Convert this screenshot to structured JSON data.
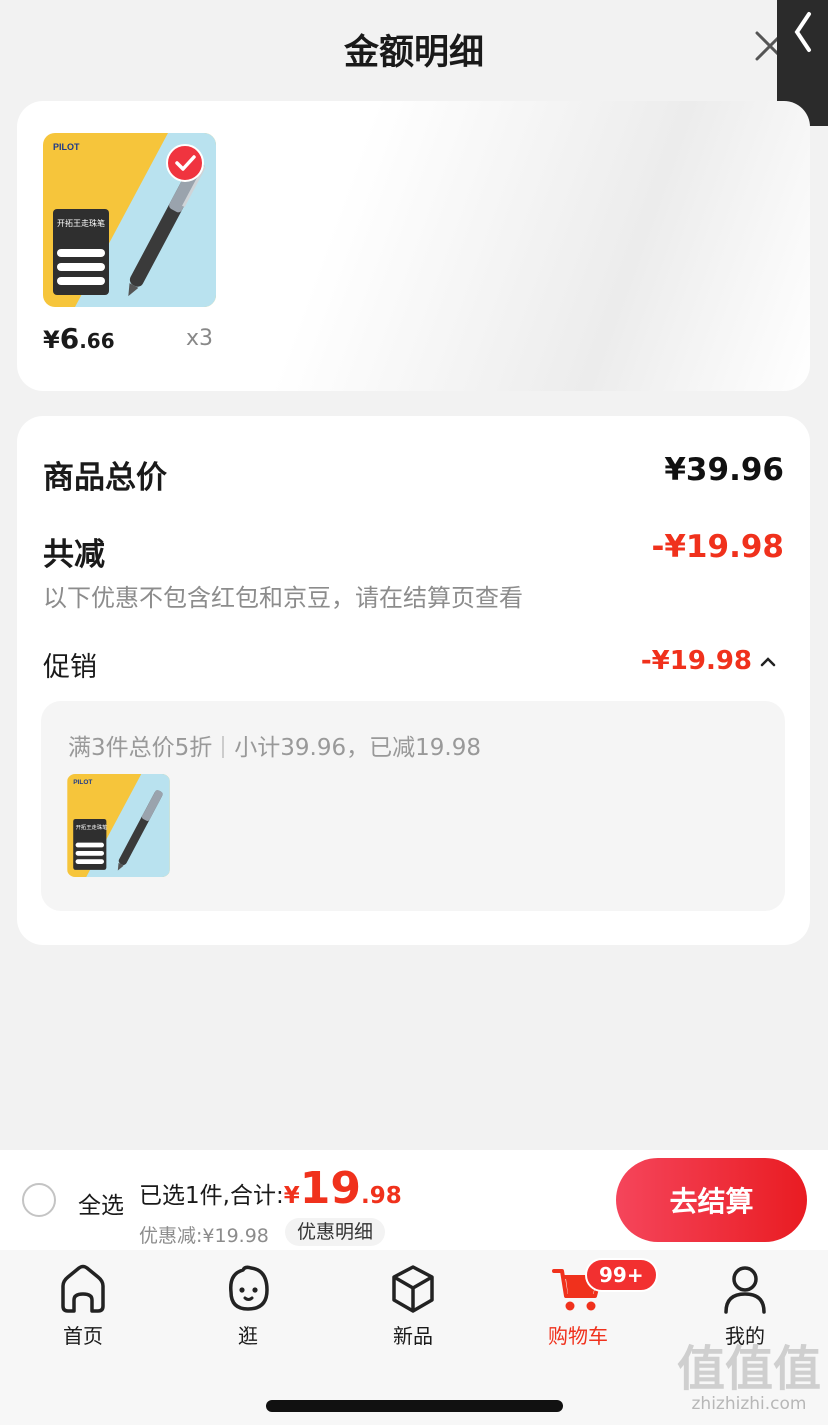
{
  "header": {
    "title": "金额明细"
  },
  "product": {
    "price_currency": "¥",
    "price_int": "6",
    "price_dec": ".66",
    "quantity": "x3",
    "brand": "PILOT",
    "packaging_title": "开拓王走珠笔"
  },
  "details": {
    "total_label": "商品总价",
    "total_value": "¥39.96",
    "discount_label": "共减",
    "discount_value": "-¥19.98",
    "note": "以下优惠不包含红包和京豆，请在结算页查看",
    "promo_label": "促销",
    "promo_value": "-¥19.98",
    "promo_rule": "满3件总价5折",
    "promo_subtotal": "小计39.96，已减19.98"
  },
  "bottom_bar": {
    "select_all_label": "全选",
    "summary_prefix": "已选1件,合计:",
    "amount_currency": "¥",
    "amount_int": "19",
    "amount_dec": ".98",
    "saved": "优惠减:¥19.98",
    "detail_link": "优惠明细",
    "checkout_label": "去结算"
  },
  "tabs": [
    {
      "label": "首页",
      "icon": "home-icon"
    },
    {
      "label": "逛",
      "icon": "face-icon"
    },
    {
      "label": "新品",
      "icon": "cube-icon"
    },
    {
      "label": "购物车",
      "icon": "cart-icon",
      "active": true,
      "badge": "99+"
    },
    {
      "label": "我的",
      "icon": "user-icon"
    }
  ],
  "watermark": {
    "big": "值值值",
    "small": "zhizhizhi.com"
  },
  "colors": {
    "accent": "#f0311c",
    "checkout": "#e91c22"
  }
}
